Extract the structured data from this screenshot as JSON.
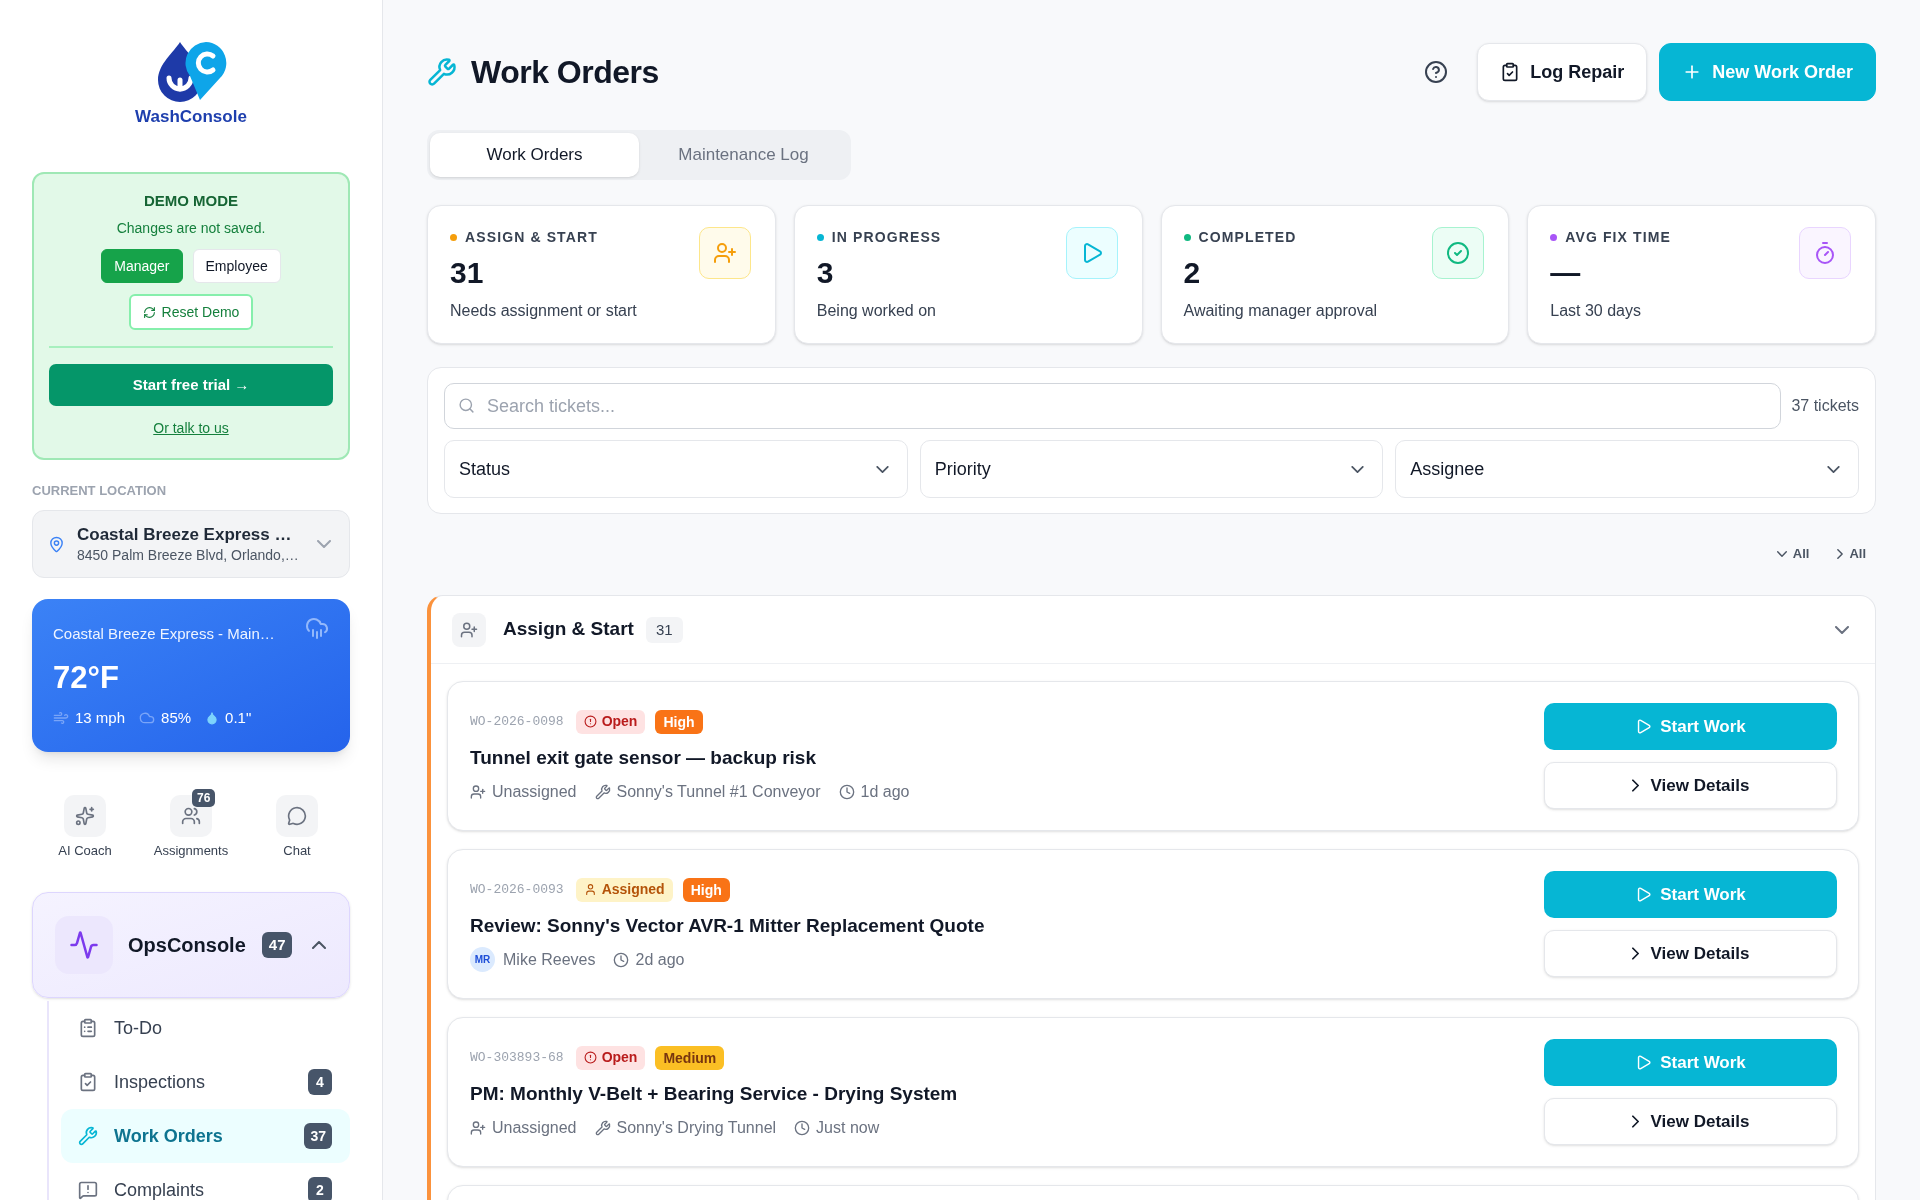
{
  "sidebar": {
    "logo_text": "WashConsole",
    "demo": {
      "title": "DEMO MODE",
      "note": "Changes are not saved.",
      "roles": [
        {
          "label": "Manager",
          "selected": true
        },
        {
          "label": "Employee",
          "selected": false
        }
      ],
      "reset": "Reset Demo",
      "trial": "Start free trial →",
      "talk": "Or talk to us"
    },
    "location": {
      "label": "CURRENT LOCATION",
      "name": "Coastal Breeze Express …",
      "address": "8450 Palm Breeze Blvd, Orlando,…"
    },
    "weather": {
      "location": "Coastal Breeze Express - Main…",
      "temperature": "72°F",
      "wind": "13 mph",
      "humidity": "85%",
      "precipitation": "0.1\""
    },
    "shortcuts": [
      {
        "label": "AI Coach",
        "kind": "coach"
      },
      {
        "label": "Assignments",
        "kind": "assignments",
        "badge": "76"
      },
      {
        "label": "Chat",
        "kind": "chat"
      }
    ],
    "section": {
      "title": "OpsConsole",
      "badge": "47",
      "expanded": true,
      "items": [
        {
          "label": "To-Do",
          "kind": "todo",
          "selected": false
        },
        {
          "label": "Inspections",
          "kind": "inspections",
          "badge": "4",
          "selected": false
        },
        {
          "label": "Work Orders",
          "kind": "repairs",
          "badge": "37",
          "selected": true
        },
        {
          "label": "Complaints",
          "kind": "complaints",
          "badge": "2",
          "selected": false
        }
      ]
    }
  },
  "header": {
    "title": "Work Orders",
    "actions": [
      {
        "label": "Log Repair",
        "kind": "log"
      },
      {
        "label": "New Work Order",
        "kind": "new"
      }
    ]
  },
  "tabs": [
    {
      "label": "Work Orders",
      "selected": true
    },
    {
      "label": "Maintenance Log",
      "selected": false
    }
  ],
  "stats": [
    {
      "label": "ASSIGN & START",
      "value": "31",
      "caption": "Needs assignment or start",
      "color": "#f59e0b",
      "kind": "assign"
    },
    {
      "label": "IN PROGRESS",
      "value": "3",
      "caption": "Being worked on",
      "color": "#06b6d4",
      "kind": "progress"
    },
    {
      "label": "COMPLETED",
      "value": "2",
      "caption": "Awaiting manager approval",
      "color": "#10b981",
      "kind": "completed"
    },
    {
      "label": "AVG FIX TIME",
      "value": "—",
      "caption": "Last 30 days",
      "color": "#a855f7",
      "kind": "time"
    }
  ],
  "filters": {
    "search": {
      "placeholder": "Search tickets..."
    },
    "count": "37 tickets",
    "selects": [
      {
        "label": "Status"
      },
      {
        "label": "Priority"
      },
      {
        "label": "Assignee"
      }
    ]
  },
  "bulk_actions": [
    {
      "label": "All",
      "kind": "expand"
    },
    {
      "label": "All",
      "kind": "collapse"
    }
  ],
  "group": {
    "title": "Assign & Start",
    "count": "31",
    "expanded": true,
    "color": "#fb923c",
    "orders": [
      {
        "id": "WO-2026-0098",
        "status": {
          "label": "Open",
          "kind": "open"
        },
        "priority": {
          "label": "High",
          "kind": "high"
        },
        "title": "Tunnel exit gate sensor — backup risk",
        "meta": [
          {
            "kind": "unassigned",
            "text": "Unassigned"
          },
          {
            "kind": "equipment",
            "text": "Sonny's Tunnel #1 Conveyor"
          },
          {
            "kind": "time",
            "text": "1d ago"
          }
        ],
        "actions": [
          {
            "label": "Start Work",
            "kind": "start"
          },
          {
            "label": "View Details",
            "kind": "details"
          }
        ]
      },
      {
        "id": "WO-2026-0093",
        "status": {
          "label": "Assigned",
          "kind": "assigned"
        },
        "priority": {
          "label": "High",
          "kind": "high"
        },
        "title": "Review: Sonny's Vector AVR-1 Mitter Replacement Quote",
        "meta": [
          {
            "kind": "assignee",
            "initials": "MR",
            "text": "Mike Reeves"
          },
          {
            "kind": "time",
            "text": "2d ago"
          }
        ],
        "actions": [
          {
            "label": "Start Work",
            "kind": "start"
          },
          {
            "label": "View Details",
            "kind": "details"
          }
        ]
      },
      {
        "id": "WO-303893-68",
        "status": {
          "label": "Open",
          "kind": "open"
        },
        "priority": {
          "label": "Medium",
          "kind": "medium"
        },
        "title": "PM: Monthly V-Belt + Bearing Service - Drying System",
        "meta": [
          {
            "kind": "unassigned",
            "text": "Unassigned"
          },
          {
            "kind": "equipment",
            "text": "Sonny's Drying Tunnel"
          },
          {
            "kind": "time",
            "text": "Just now"
          }
        ],
        "actions": [
          {
            "label": "Start Work",
            "kind": "start"
          },
          {
            "label": "View Details",
            "kind": "details"
          }
        ]
      }
    ]
  }
}
